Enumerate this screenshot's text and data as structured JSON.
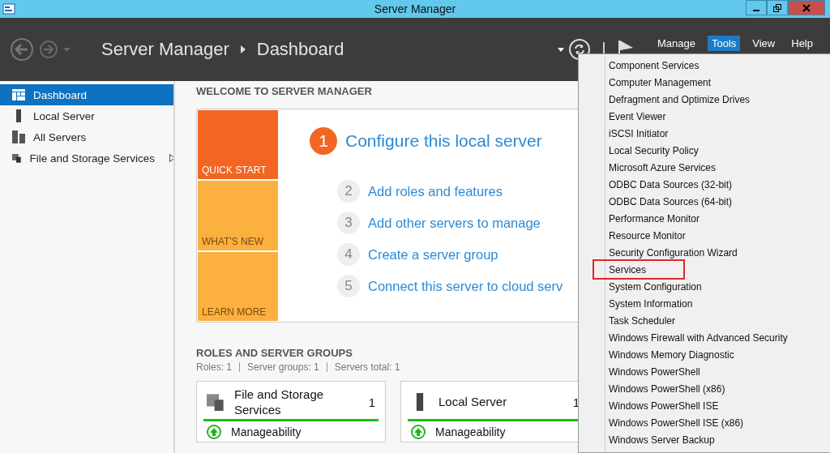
{
  "window": {
    "title": "Server Manager"
  },
  "header": {
    "breadcrumb": [
      "Server Manager",
      "Dashboard"
    ],
    "menus": [
      {
        "label": "Manage",
        "selected": false
      },
      {
        "label": "Tools",
        "selected": true
      },
      {
        "label": "View",
        "selected": false
      },
      {
        "label": "Help",
        "selected": false
      }
    ]
  },
  "sidebar": {
    "items": [
      {
        "label": "Dashboard",
        "kind": "dashboard",
        "selected": true,
        "expandable": false
      },
      {
        "label": "Local Server",
        "kind": "server",
        "selected": false,
        "expandable": false
      },
      {
        "label": "All Servers",
        "kind": "servers",
        "selected": false,
        "expandable": false
      },
      {
        "label": "File and Storage Services",
        "kind": "storage",
        "selected": false,
        "expandable": true
      }
    ]
  },
  "welcome": {
    "heading": "WELCOME TO SERVER MANAGER",
    "tiles": [
      {
        "label": "QUICK START",
        "kind": "primary"
      },
      {
        "label": "WHAT'S NEW",
        "kind": "secondary"
      },
      {
        "label": "LEARN MORE",
        "kind": "secondary"
      }
    ],
    "steps": [
      {
        "number": "1",
        "text": "Configure this local server",
        "primary": true
      },
      {
        "number": "2",
        "text": "Add roles and features",
        "primary": false
      },
      {
        "number": "3",
        "text": "Add other servers to manage",
        "primary": false
      },
      {
        "number": "4",
        "text": "Create a server group",
        "primary": false
      },
      {
        "number": "5",
        "text": "Connect this server to cloud serv",
        "primary": false
      }
    ]
  },
  "roles": {
    "heading": "ROLES AND SERVER GROUPS",
    "summary": [
      "Roles: 1",
      "Server groups: 1",
      "Servers total: 1"
    ],
    "cards": [
      {
        "title": "File and Storage Services",
        "count": "1",
        "kind": "storage",
        "status": "Manageability"
      },
      {
        "title": "Local Server",
        "count": "1",
        "kind": "server",
        "status": "Manageability"
      }
    ]
  },
  "tools_menu": {
    "items": [
      {
        "label": "Component Services",
        "highlighted": false
      },
      {
        "label": "Computer Management",
        "highlighted": false
      },
      {
        "label": "Defragment and Optimize Drives",
        "highlighted": false
      },
      {
        "label": "Event Viewer",
        "highlighted": false
      },
      {
        "label": "iSCSI Initiator",
        "highlighted": false
      },
      {
        "label": "Local Security Policy",
        "highlighted": false
      },
      {
        "label": "Microsoft Azure Services",
        "highlighted": false
      },
      {
        "label": "ODBC Data Sources (32-bit)",
        "highlighted": false
      },
      {
        "label": "ODBC Data Sources (64-bit)",
        "highlighted": false
      },
      {
        "label": "Performance Monitor",
        "highlighted": false
      },
      {
        "label": "Resource Monitor",
        "highlighted": false
      },
      {
        "label": "Security Configuration Wizard",
        "highlighted": false
      },
      {
        "label": "Services",
        "highlighted": true
      },
      {
        "label": "System Configuration",
        "highlighted": false
      },
      {
        "label": "System Information",
        "highlighted": false
      },
      {
        "label": "Task Scheduler",
        "highlighted": false
      },
      {
        "label": "Windows Firewall with Advanced Security",
        "highlighted": false
      },
      {
        "label": "Windows Memory Diagnostic",
        "highlighted": false
      },
      {
        "label": "Windows PowerShell",
        "highlighted": false
      },
      {
        "label": "Windows PowerShell (x86)",
        "highlighted": false
      },
      {
        "label": "Windows PowerShell ISE",
        "highlighted": false
      },
      {
        "label": "Windows PowerShell ISE (x86)",
        "highlighted": false
      },
      {
        "label": "Windows Server Backup",
        "highlighted": false
      }
    ]
  }
}
